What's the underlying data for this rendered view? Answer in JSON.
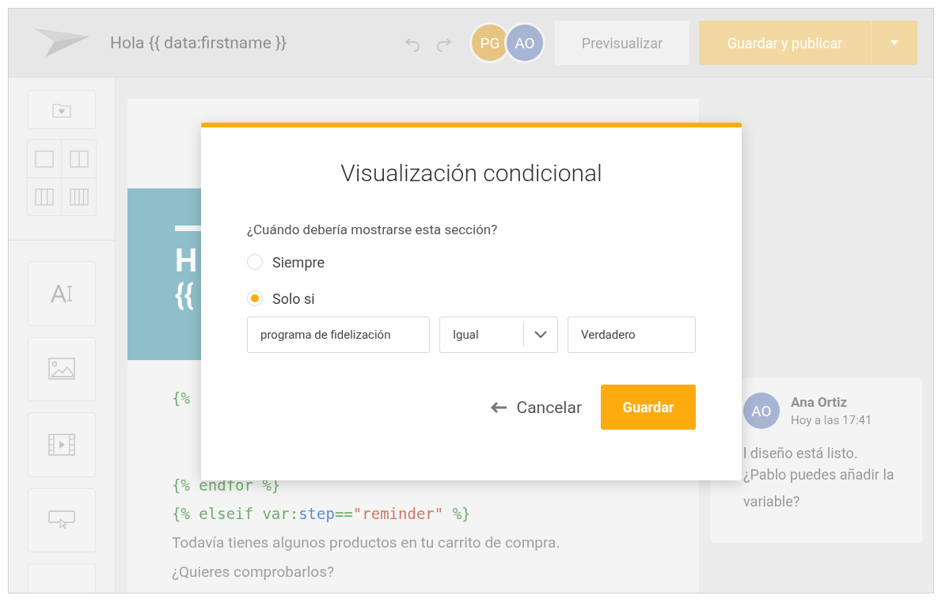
{
  "app_bar": {
    "title": "Hola {{ data:firstname }}",
    "avatars": [
      {
        "initials": "PG",
        "color": "#e6c582"
      },
      {
        "initials": "AO",
        "color": "#a7b4d2"
      }
    ],
    "preview_button": "Previsualizar",
    "publish_button": "Guardar y publicar"
  },
  "sidebar": {
    "text_tool_glyph": "A"
  },
  "email": {
    "hero_heading": "H",
    "hero_subheading": "{{",
    "code_lines": [
      [
        {
          "text": "{%",
          "kind": "keyword"
        }
      ],
      [
        {
          "text": "{% endfor %}",
          "kind": "keyword"
        }
      ],
      [
        {
          "text": "{% elseif var:",
          "kind": "keyword"
        },
        {
          "text": "step",
          "kind": "variable"
        },
        {
          "text": "==",
          "kind": "keyword"
        },
        {
          "text": "\"reminder\"",
          "kind": "string"
        },
        {
          "text": " %}",
          "kind": "keyword"
        }
      ]
    ],
    "body_lines": [
      "Todavía tienes algunos productos en tu carrito de compra.",
      "¿Quieres comprobarlos?"
    ]
  },
  "comment": {
    "initials": "AO",
    "author": "Ana Ortiz",
    "time": "Hoy a las 17:41",
    "lines": [
      "l diseño está listo.",
      "¿Pablo puedes añadir la variable?"
    ]
  },
  "dialog": {
    "title": "Visualización condicional",
    "question": "¿Cuándo debería mostrarse esta sección?",
    "options": [
      {
        "label": "Siempre",
        "selected": false
      },
      {
        "label": "Solo si",
        "selected": true
      }
    ],
    "condition": {
      "field": "programa de fidelización",
      "operator": "Igual",
      "value": "Verdadero"
    },
    "cancel_button": "Cancelar",
    "save_button": "Guardar"
  }
}
